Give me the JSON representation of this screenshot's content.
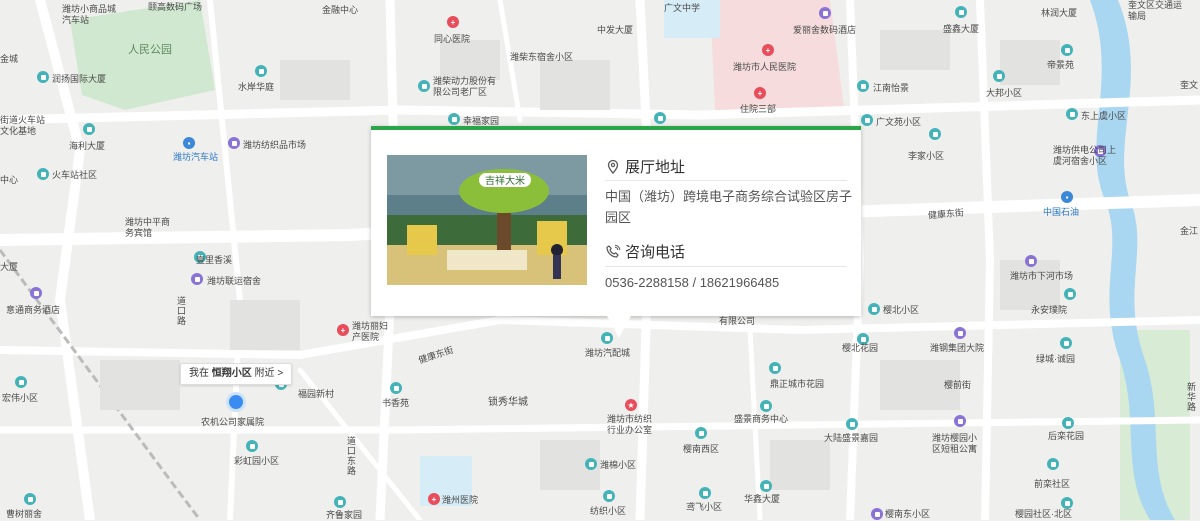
{
  "popup": {
    "address_title": "展厅地址",
    "address_text": "中国（潍坊）跨境电子商务综合试验区房子园区",
    "phone_title": "咨询电话",
    "phone_text": "0536-2288158 / 18621966485",
    "photo_sign": "吉祥大米",
    "accent_color": "#2aa648"
  },
  "nearby": {
    "prefix": "我在",
    "place": "恒翔小区",
    "suffix": "附近 >"
  },
  "map_labels": {
    "l1": "潍坊小商品城汽车站",
    "l2": "颐高数码广场",
    "l3": "金融中心",
    "l4": "同心医院",
    "l5": "潍柴东宿舍小区",
    "l6": "中发大厦",
    "l7": "广文中学",
    "l8": "爱丽舍数码酒店",
    "l9": "盛鑫大厦",
    "l10": "林润大厦",
    "l11": "奎文区交通运输局",
    "l12": "人民公园",
    "l13": "金城",
    "l14": "润扬国际大厦",
    "l15": "水岸华庭",
    "l16": "潍柴动力股份有限公司老厂区",
    "l17": "潍坊市人民医院",
    "l18": "住院三部",
    "l19": "江南怡景",
    "l20": "帝景苑",
    "l21": "大邦小区",
    "l22": "奎文",
    "l23": "街道火车站文化基地",
    "l24": "海利大厦",
    "l25": "潍坊汽车站",
    "l26": "潍坊纺织品市场",
    "l27": "幸福家园",
    "l28": "广文苑小区",
    "l29": "东上虞小区",
    "l30": "中心",
    "l31": "火车站社区",
    "l32": "李家小区",
    "l33": "潍坊供电公司上虞河宿舍小区",
    "l34": "中国石油",
    "l35": "潍坊中平商务宾馆",
    "l36": "健康东街",
    "l37": "壹里香溪",
    "l38": "潍坊联运宿舍",
    "l39": "金江",
    "l40": "大厦",
    "l41": "潍坊市下河市场",
    "l42": "道口路",
    "l43": "意通商务酒店",
    "l44": "潍坊丽妇产医院",
    "l45": "樱北小区",
    "l46": "永安璞院",
    "l47": "有限公司",
    "l48": "樱北花园",
    "l49": "潍钢集团大院",
    "l50": "绿城·诚园",
    "l51": "健康东街",
    "l52": "潍坊汽配城",
    "l53": "宏伟小区",
    "l54": "福园新村",
    "l55": "书香苑",
    "l56": "锁秀华城",
    "l57": "鼎正城市花园",
    "l58": "樱前街",
    "l59": "新华路",
    "l60": "农机公司家属院",
    "l61": "潍坊市纺织行业办公室",
    "l62": "盛景商务中心",
    "l63": "大陆盛景嘉园",
    "l64": "潍坊樱园小区短租公寓",
    "l65": "后栾花园",
    "l66": "道口东路",
    "l67": "彩虹园小区",
    "l68": "樱南西区",
    "l69": "潍棉小区",
    "l70": "前栾社区",
    "l71": "曹树丽舍",
    "l72": "潍州医院",
    "l73": "齐鲁家园",
    "l74": "纺织小区",
    "l75": "鸢飞小区",
    "l76": "华鑫大厦",
    "l77": "樱南东小区",
    "l78": "樱园社区·北区"
  }
}
